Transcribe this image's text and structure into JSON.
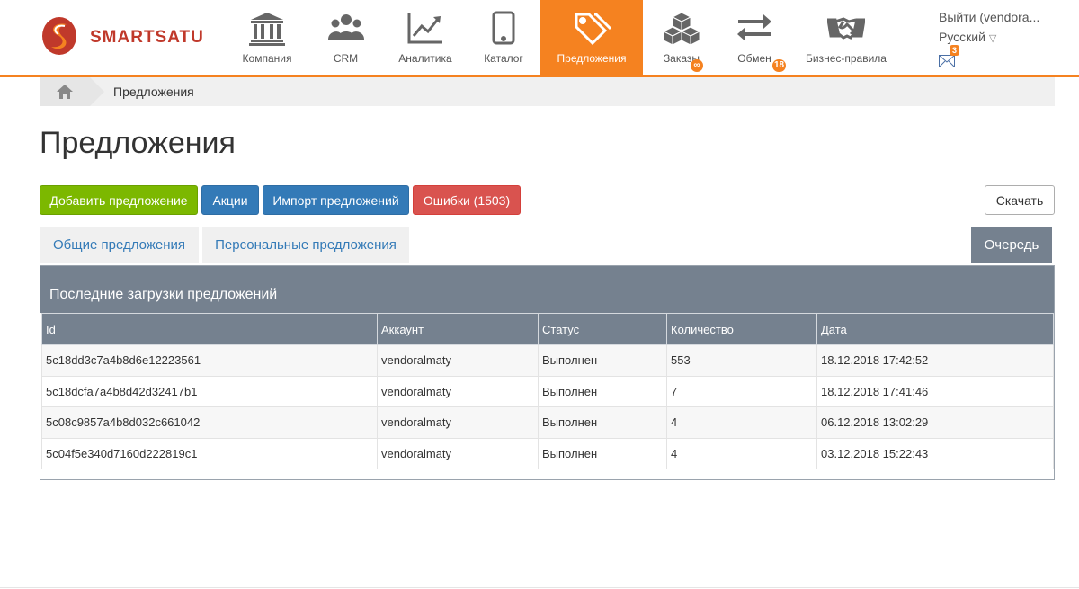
{
  "brand": {
    "name": "SMARTSATU",
    "accent": "#f58220",
    "logo_red": "#c0392b"
  },
  "nav": [
    {
      "label": "Компания",
      "icon": "bank-icon"
    },
    {
      "label": "CRM",
      "icon": "users-icon"
    },
    {
      "label": "Аналитика",
      "icon": "chart-icon"
    },
    {
      "label": "Каталог",
      "icon": "tablet-icon"
    },
    {
      "label": "Предложения",
      "icon": "tags-icon",
      "active": true
    },
    {
      "label": "Заказы",
      "icon": "cubes-icon",
      "badge": "∞"
    },
    {
      "label": "Обмен",
      "icon": "exchange-icon",
      "badge": "18"
    },
    {
      "label": "Бизнес-правила",
      "icon": "handshake-icon"
    }
  ],
  "user": {
    "logout": "Выйти (vendora...",
    "language": "Русский",
    "language_caret": "▽",
    "mail_count": "3"
  },
  "breadcrumb": {
    "current": "Предложения"
  },
  "page": {
    "title": "Предложения"
  },
  "actions": {
    "add": "Добавить предложение",
    "promos": "Акции",
    "import": "Импорт предложений",
    "errors": "Ошибки (1503)",
    "download": "Скачать"
  },
  "tabs": {
    "general": "Общие предложения",
    "personal": "Персональные предложения",
    "queue": "Очередь"
  },
  "panel": {
    "title": "Последние загрузки предложений",
    "columns": [
      "Id",
      "Аккаунт",
      "Статус",
      "Количество",
      "Дата"
    ],
    "rows": [
      [
        "5c18dd3c7a4b8d6e12223561",
        "vendoralmaty",
        "Выполнен",
        "553",
        "18.12.2018 17:42:52"
      ],
      [
        "5c18dcfa7a4b8d42d32417b1",
        "vendoralmaty",
        "Выполнен",
        "7",
        "18.12.2018 17:41:46"
      ],
      [
        "5c08c9857a4b8d032c661042",
        "vendoralmaty",
        "Выполнен",
        "4",
        "06.12.2018 13:02:29"
      ],
      [
        "5c04f5e340d7160d222819c1",
        "vendoralmaty",
        "Выполнен",
        "4",
        "03.12.2018 15:22:43"
      ]
    ]
  }
}
